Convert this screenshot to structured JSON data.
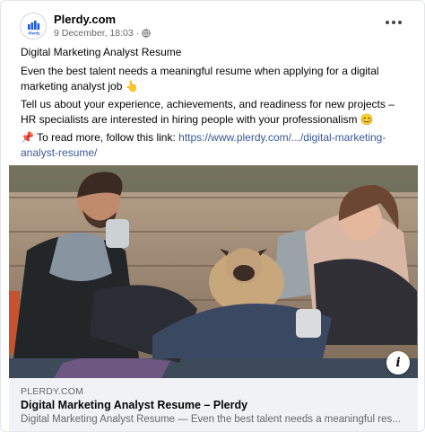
{
  "post": {
    "page_name": "Plerdy.com",
    "date": "9 December, 18:03",
    "separator": "·",
    "audience_icon": "globe-icon",
    "avatar_text": "Plerdy",
    "paragraphs": {
      "title": "Digital Marketing Analyst Resume",
      "p1": "Even the best talent needs a meaningful resume when applying for a digital marketing analyst job",
      "p1_emoji": "👆",
      "p2": "Tell us about your experience, achievements, and readiness for new projects – HR specialists are interested in hiring people with your professionalism",
      "p2_emoji": "😊",
      "p3_emoji": "📌",
      "p3": "To read more, follow this link:",
      "link": "https://www.plerdy.com/.../digital-marketing-analyst-resume/"
    }
  },
  "link_preview": {
    "domain": "PLERDY.COM",
    "title": "Digital Marketing Analyst Resume – Plerdy",
    "description": "Digital Marketing Analyst Resume — Even the best talent needs a meaningful res..."
  },
  "photo": {
    "info_label": "i"
  },
  "colors": {
    "link": "#385898",
    "meta": "#65676b",
    "footer_bg": "#f0f2f5",
    "brand_blue": "#1877f2"
  }
}
